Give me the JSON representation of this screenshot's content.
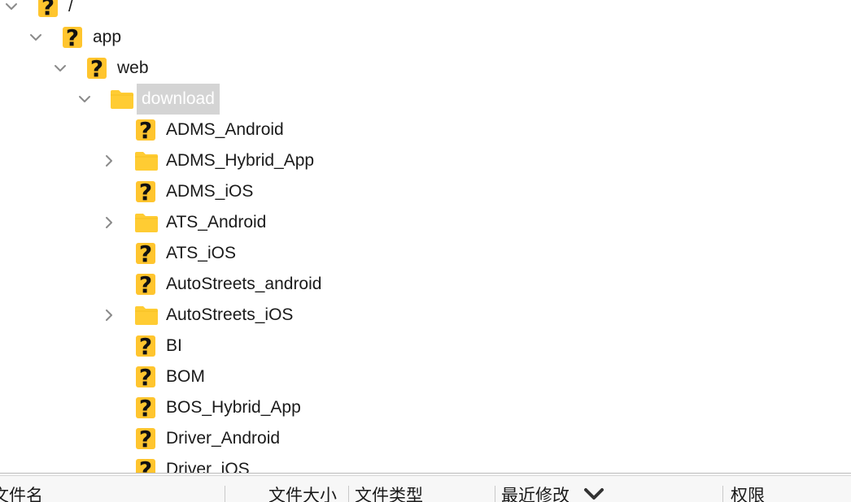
{
  "tree": {
    "items": [
      {
        "label": "/",
        "icon": "question-file-icon",
        "chevron": "down"
      },
      {
        "label": "app",
        "icon": "question-file-icon",
        "chevron": "down"
      },
      {
        "label": "web",
        "icon": "question-file-icon",
        "chevron": "down"
      },
      {
        "label": "download",
        "icon": "folder-icon",
        "chevron": "down",
        "selected": true
      },
      {
        "label": "ADMS_Android",
        "icon": "question-file-icon",
        "chevron": "none"
      },
      {
        "label": "ADMS_Hybrid_App",
        "icon": "folder-icon",
        "chevron": "right"
      },
      {
        "label": "ADMS_iOS",
        "icon": "question-file-icon",
        "chevron": "none"
      },
      {
        "label": "ATS_Android",
        "icon": "folder-icon",
        "chevron": "right"
      },
      {
        "label": "ATS_iOS",
        "icon": "question-file-icon",
        "chevron": "none"
      },
      {
        "label": "AutoStreets_android",
        "icon": "question-file-icon",
        "chevron": "none"
      },
      {
        "label": "AutoStreets_iOS",
        "icon": "folder-icon",
        "chevron": "right"
      },
      {
        "label": "BI",
        "icon": "question-file-icon",
        "chevron": "none"
      },
      {
        "label": "BOM",
        "icon": "question-file-icon",
        "chevron": "none"
      },
      {
        "label": "BOS_Hybrid_App",
        "icon": "question-file-icon",
        "chevron": "none"
      },
      {
        "label": "Driver_Android",
        "icon": "question-file-icon",
        "chevron": "none"
      },
      {
        "label": "Driver_iOS",
        "icon": "question-file-icon",
        "chevron": "none"
      }
    ]
  },
  "file_list_header": {
    "name": "文件名",
    "size": "文件大小",
    "type": "文件类型",
    "modified": "最近修改",
    "permissions": "权限"
  },
  "colors": {
    "folder": "#FFCC33",
    "question": "#FFC52E",
    "selection_bg": "#D4D4D4"
  }
}
